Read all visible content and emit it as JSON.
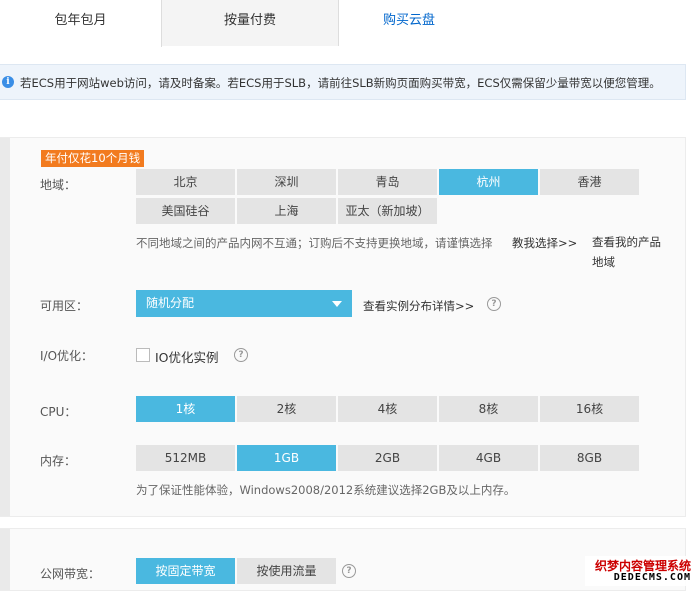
{
  "tabs": {
    "annual": "包年包月",
    "payg": "按量付费",
    "buy_disk": "购买云盘"
  },
  "notice": {
    "text": "若ECS用于网站web访问，请及时备案。若ECS用于SLB，请前往SLB新购页面购买带宽，ECS仅需保留少量带宽以便您管理。"
  },
  "promo": "年付仅花10个月钱",
  "region": {
    "label": "地域：",
    "options": [
      "北京",
      "深圳",
      "青岛",
      "杭州",
      "香港",
      "美国硅谷",
      "上海",
      "亚太（新加坡）"
    ],
    "selected": "杭州",
    "hint": "不同地域之间的产品内网不互通；订购后不支持更换地域，请谨慎选择",
    "help_link": "教我选择>>",
    "products_link": "查看我的产品地域"
  },
  "zone": {
    "label": "可用区：",
    "value": "随机分配",
    "detail_link": "查看实例分布详情>>"
  },
  "io": {
    "label": "I/O优化：",
    "checkbox_label": "IO优化实例"
  },
  "cpu": {
    "label": "CPU：",
    "options": [
      "1核",
      "2核",
      "4核",
      "8核",
      "16核"
    ],
    "selected": "1核"
  },
  "memory": {
    "label": "内存：",
    "options": [
      "512MB",
      "1GB",
      "2GB",
      "4GB",
      "8GB"
    ],
    "selected": "1GB",
    "hint": "为了保证性能体验，Windows2008/2012系统建议选择2GB及以上内存。"
  },
  "bandwidth": {
    "label": "公网带宽：",
    "options": [
      "按固定带宽",
      "按使用流量"
    ],
    "selected": "按固定带宽"
  },
  "watermark": {
    "line1": "织梦内容管理系统",
    "line2": "DEDECMS.COM"
  },
  "colors": {
    "selected_bg": "#4ab8e0",
    "promo_bg": "#f27b1f",
    "link_blue": "#0066cc"
  }
}
